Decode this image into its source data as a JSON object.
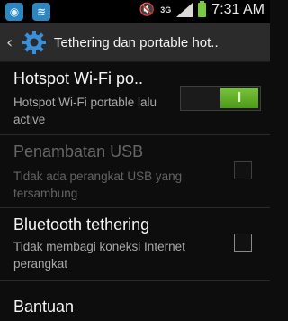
{
  "statusbar": {
    "network_type": "3G",
    "time": "7:31 AM",
    "icons": [
      "notification-icon",
      "wifi-icon",
      "mute-icon",
      "signal-icon",
      "battery-icon"
    ]
  },
  "actionbar": {
    "title": "Tethering dan portable hot..",
    "icon": "settings-gear-icon"
  },
  "items": [
    {
      "title": "Hotspot Wi-Fi po..",
      "subtitle": "Hotspot Wi-Fi portable lalu active",
      "control": "toggle",
      "toggle_label": "I",
      "enabled": true
    },
    {
      "title": "Penambatan USB",
      "subtitle": "Tidak ada perangkat USB yang tersambung",
      "control": "checkbox",
      "checked": false,
      "enabled": false
    },
    {
      "title": "Bluetooth tethering",
      "subtitle": "Tidak membagi koneksi Internet perangkat",
      "control": "checkbox",
      "checked": false,
      "enabled": true
    },
    {
      "title": "Bantuan",
      "enabled": true
    }
  ],
  "colors": {
    "toggle_on": "#5fae28",
    "wifi_badge": "#2e86c1",
    "battery": "#7ac943"
  }
}
